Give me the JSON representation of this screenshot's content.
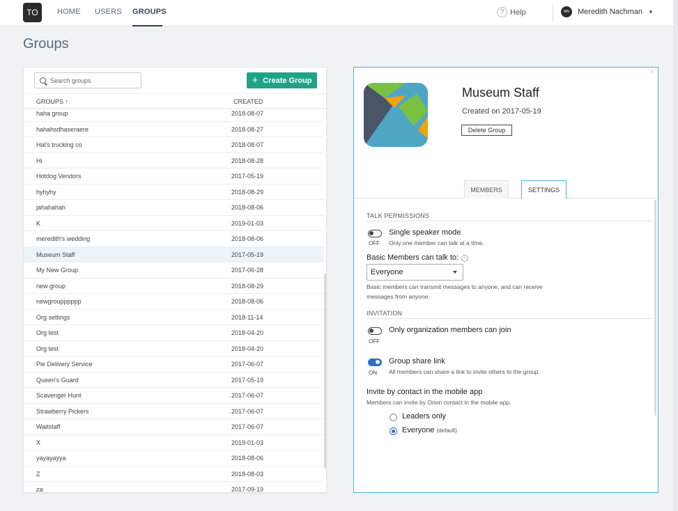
{
  "nav": {
    "logo": "TO",
    "links": [
      "HOME",
      "USERS",
      "GROUPS"
    ],
    "help": "Help",
    "user_initials": "MN",
    "user_name": "Meredith Nachman"
  },
  "page_title": "Groups",
  "list": {
    "search_placeholder": "Search groups",
    "create_label": "Create Group",
    "col_groups": "GROUPS ↑",
    "col_created": "CREATED",
    "rows": [
      {
        "name": "haha group",
        "created": "2018-08-07"
      },
      {
        "name": "hahahsdhaseraere",
        "created": "2018-08-27"
      },
      {
        "name": "Hal's trucking co",
        "created": "2018-08-07"
      },
      {
        "name": "Hi",
        "created": "2018-08-28"
      },
      {
        "name": "Hotdog Vendors",
        "created": "2017-05-19"
      },
      {
        "name": "hyhyhy",
        "created": "2018-08-29"
      },
      {
        "name": "jahahahah",
        "created": "2018-08-06"
      },
      {
        "name": "K",
        "created": "2019-01-03"
      },
      {
        "name": "meredith's wedding",
        "created": "2018-08-06"
      },
      {
        "name": "Museum Staff",
        "created": "2017-05-19"
      },
      {
        "name": "My New Group",
        "created": "2017-06-28"
      },
      {
        "name": "new group",
        "created": "2018-08-29"
      },
      {
        "name": "newgroupppppp",
        "created": "2018-08-06"
      },
      {
        "name": "Org settings",
        "created": "2018-11-14"
      },
      {
        "name": "Org test",
        "created": "2018-04-20"
      },
      {
        "name": "Org test",
        "created": "2018-04-20"
      },
      {
        "name": "Pie Delivery Service",
        "created": "2017-06-07"
      },
      {
        "name": "Queen's Guard",
        "created": "2017-05-19"
      },
      {
        "name": "Scavenger Hunt",
        "created": "2017-06-07"
      },
      {
        "name": "Strawberry Pickers",
        "created": "2017-06-07"
      },
      {
        "name": "Waitstaff",
        "created": "2017-06-07"
      },
      {
        "name": "X",
        "created": "2019-01-03"
      },
      {
        "name": "yayayayya",
        "created": "2018-08-06"
      },
      {
        "name": "Z",
        "created": "2018-08-03"
      },
      {
        "name": "za",
        "created": "2017-09-19"
      }
    ]
  },
  "detail": {
    "close": "×",
    "name": "Museum Staff",
    "created": "Created on 2017-05-19",
    "delete_label": "Delete Group",
    "tab_members": "MEMBERS",
    "tab_settings": "SETTINGS",
    "talk_permissions": "TALK PERMISSIONS",
    "single_speaker_label": "Single speaker mode",
    "single_speaker_desc": "Only one member can talk at a time.",
    "single_speaker_state": "OFF",
    "basic_members_label": "Basic Members can talk to:",
    "basic_members_value": "Everyone",
    "basic_members_desc_1": "Basic members can transmit messages to anyone, and can receive",
    "basic_members_desc_2": "messages from anyone.",
    "invitation": "INVITATION",
    "org_only_label": "Only organization members can join",
    "org_only_state": "OFF",
    "share_link_label": "Group share link",
    "share_link_desc": "All members can share a link to invite others to the group.",
    "share_link_state": "ON",
    "invite_label": "Invite by contact in the mobile app",
    "invite_desc": "Members can invite by Orion contact in the mobile app.",
    "radio_leaders": "Leaders only",
    "radio_everyone": "Everyone",
    "radio_default": "(default)"
  },
  "colors": {
    "accent_green": "#1ea388",
    "accent_blue": "#2a6fc9",
    "selected_row": "#eaf4f9"
  }
}
